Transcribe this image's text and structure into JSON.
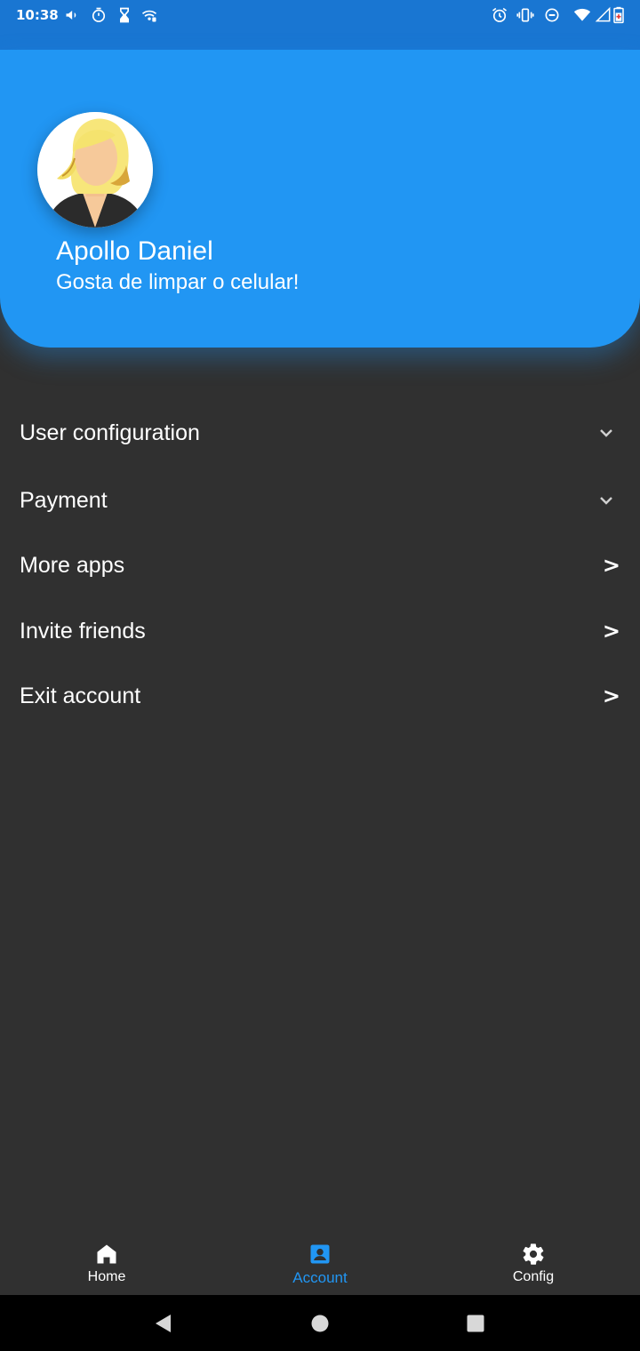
{
  "status_bar": {
    "time": "10:38",
    "left_icons": [
      "megaphone-icon",
      "timer-icon",
      "hourglass-icon",
      "wifi-calling-icon"
    ],
    "right_icons": [
      "alarm-icon",
      "vibrate-icon",
      "do-not-disturb-icon",
      "wifi-icon",
      "signal-icon",
      "battery-icon"
    ]
  },
  "profile": {
    "name": "Apollo Daniel",
    "bio": "Gosta de limpar o celular!"
  },
  "menu": {
    "items": [
      {
        "label": "User configuration",
        "indicator": "chevron-down"
      },
      {
        "label": "Payment",
        "indicator": "chevron-down"
      },
      {
        "label": "More apps",
        "indicator": ">"
      },
      {
        "label": "Invite friends",
        "indicator": ">"
      },
      {
        "label": "Exit account",
        "indicator": ">"
      }
    ]
  },
  "bottom_nav": {
    "items": [
      {
        "label": "Home",
        "icon": "home-icon",
        "active": false
      },
      {
        "label": "Account",
        "icon": "account-box-icon",
        "active": true
      },
      {
        "label": "Config",
        "icon": "gear-icon",
        "active": false
      }
    ]
  },
  "colors": {
    "accent": "#2196F3",
    "status_bar": "#1976D2",
    "background": "#303030",
    "text": "#FFFFFF"
  }
}
